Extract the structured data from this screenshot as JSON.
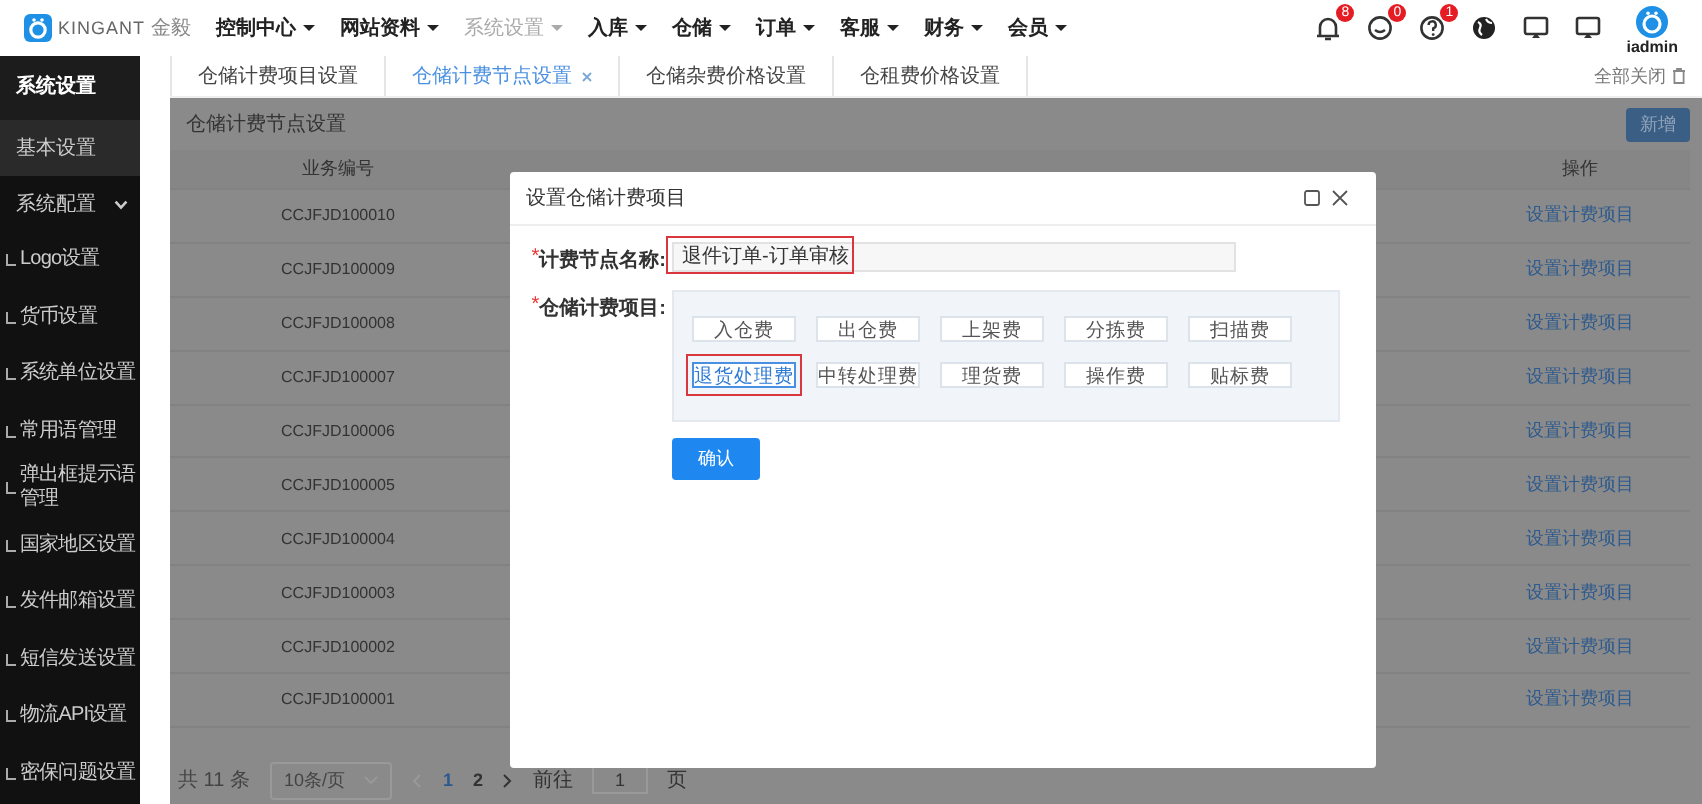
{
  "topbar": {
    "logo_text": "KINGANT",
    "logo_subtext": "金毅",
    "menu": [
      {
        "label": "控制中心",
        "disabled": false
      },
      {
        "label": "网站资料",
        "disabled": false
      },
      {
        "label": "系统设置",
        "disabled": true
      },
      {
        "label": "入库",
        "disabled": false
      },
      {
        "label": "仓储",
        "disabled": false
      },
      {
        "label": "订单",
        "disabled": false
      },
      {
        "label": "客服",
        "disabled": false
      },
      {
        "label": "财务",
        "disabled": false
      },
      {
        "label": "会员",
        "disabled": false
      }
    ],
    "notifications": [
      {
        "kind": "bell",
        "badge": "8"
      },
      {
        "kind": "chat",
        "badge": "0"
      },
      {
        "kind": "help",
        "badge": "1"
      }
    ],
    "tools": [
      {
        "kind": "globe"
      },
      {
        "kind": "screen"
      },
      {
        "kind": "screen"
      }
    ],
    "user": "iadmin"
  },
  "sidebar": {
    "title": "系统设置",
    "items": [
      {
        "label": "基本设置",
        "selected": true
      },
      {
        "label": "系统配置",
        "selected": false,
        "expanded": true,
        "children": [
          {
            "label": "Logo设置"
          },
          {
            "label": "货币设置"
          },
          {
            "label": "系统单位设置"
          },
          {
            "label": "常用语管理"
          },
          {
            "label": "弹出框提示语管理"
          },
          {
            "label": "国家地区设置"
          },
          {
            "label": "发件邮箱设置"
          },
          {
            "label": "短信发送设置"
          },
          {
            "label": "物流API设置"
          },
          {
            "label": "密保问题设置"
          }
        ]
      }
    ]
  },
  "tabs": {
    "items": [
      {
        "label": "仓储计费项目设置",
        "selected": false,
        "closable": false
      },
      {
        "label": "仓储计费节点设置",
        "selected": true,
        "closable": true
      },
      {
        "label": "仓储杂费价格设置",
        "selected": false,
        "closable": false
      },
      {
        "label": "仓租费价格设置",
        "selected": false,
        "closable": false
      }
    ],
    "close_all": "全部关闭"
  },
  "page": {
    "title": "仓储计费节点设置",
    "add_button": "新增",
    "table": {
      "columns": [
        "业务编号",
        "操作"
      ],
      "rows": [
        {
          "code": "CCJFJD100010",
          "action": "设置计费项目"
        },
        {
          "code": "CCJFJD100009",
          "action": "设置计费项目"
        },
        {
          "code": "CCJFJD100008",
          "action": "设置计费项目"
        },
        {
          "code": "CCJFJD100007",
          "action": "设置计费项目"
        },
        {
          "code": "CCJFJD100006",
          "action": "设置计费项目"
        },
        {
          "code": "CCJFJD100005",
          "action": "设置计费项目"
        },
        {
          "code": "CCJFJD100004",
          "action": "设置计费项目"
        },
        {
          "code": "CCJFJD100003",
          "action": "设置计费项目"
        },
        {
          "code": "CCJFJD100002",
          "action": "设置计费项目"
        },
        {
          "code": "CCJFJD100001",
          "action": "设置计费项目"
        }
      ]
    },
    "pagination": {
      "total": "共 11 条",
      "page_size": "10条/页",
      "pages": [
        {
          "label": "1",
          "selected": true
        },
        {
          "label": "2",
          "selected": false
        }
      ],
      "goto_label": "前往",
      "goto_value": "1",
      "goto_suffix": "页"
    }
  },
  "dialog": {
    "title": "设置仓储计费项目",
    "fields": [
      {
        "kind": "text",
        "marker": "*",
        "label": "计费节点名称:",
        "value": "退件订单-订单审核",
        "highlighted": true
      },
      {
        "kind": "tags",
        "marker": "*",
        "label": "仓储计费项目:",
        "options": [
          {
            "label": "入仓费",
            "selected": false,
            "highlighted": false
          },
          {
            "label": "出仓费",
            "selected": false,
            "highlighted": false
          },
          {
            "label": "上架费",
            "selected": false,
            "highlighted": false
          },
          {
            "label": "分拣费",
            "selected": false,
            "highlighted": false
          },
          {
            "label": "扫描费",
            "selected": false,
            "highlighted": false
          },
          {
            "label": "退货处理费",
            "selected": true,
            "highlighted": true
          },
          {
            "label": "中转处理费",
            "selected": false,
            "highlighted": false
          },
          {
            "label": "理货费",
            "selected": false,
            "highlighted": false
          },
          {
            "label": "操作费",
            "selected": false,
            "highlighted": false
          },
          {
            "label": "贴标费",
            "selected": false,
            "highlighted": false
          }
        ]
      }
    ],
    "confirm": "确认"
  }
}
